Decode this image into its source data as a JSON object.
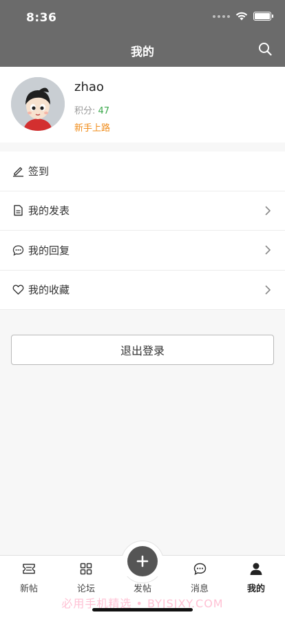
{
  "status_bar": {
    "time": "8:36"
  },
  "header": {
    "title": "我的",
    "search_icon": "search-icon"
  },
  "profile": {
    "username": "zhao",
    "points_label": "积分:",
    "points_value": "47",
    "level": "新手上路"
  },
  "menu": [
    {
      "label": "签到",
      "icon": "pencil-icon",
      "has_chevron": false
    },
    {
      "label": "我的发表",
      "icon": "document-icon",
      "has_chevron": true
    },
    {
      "label": "我的回复",
      "icon": "chat-bubble-icon",
      "has_chevron": true
    },
    {
      "label": "我的收藏",
      "icon": "heart-icon",
      "has_chevron": true
    }
  ],
  "logout_label": "退出登录",
  "tabbar": {
    "tabs": [
      {
        "label": "新帖",
        "icon": "ticket-icon"
      },
      {
        "label": "论坛",
        "icon": "grid-icon"
      },
      {
        "label": "发帖",
        "icon": "plus-icon"
      },
      {
        "label": "消息",
        "icon": "message-icon"
      },
      {
        "label": "我的",
        "icon": "person-icon",
        "active": true
      }
    ]
  },
  "watermark": "必用手机精选 • BYJSJXY.COM",
  "colors": {
    "header_bg": "#6b6b6b",
    "points_value": "#3aa84b",
    "level": "#f08c1a"
  }
}
